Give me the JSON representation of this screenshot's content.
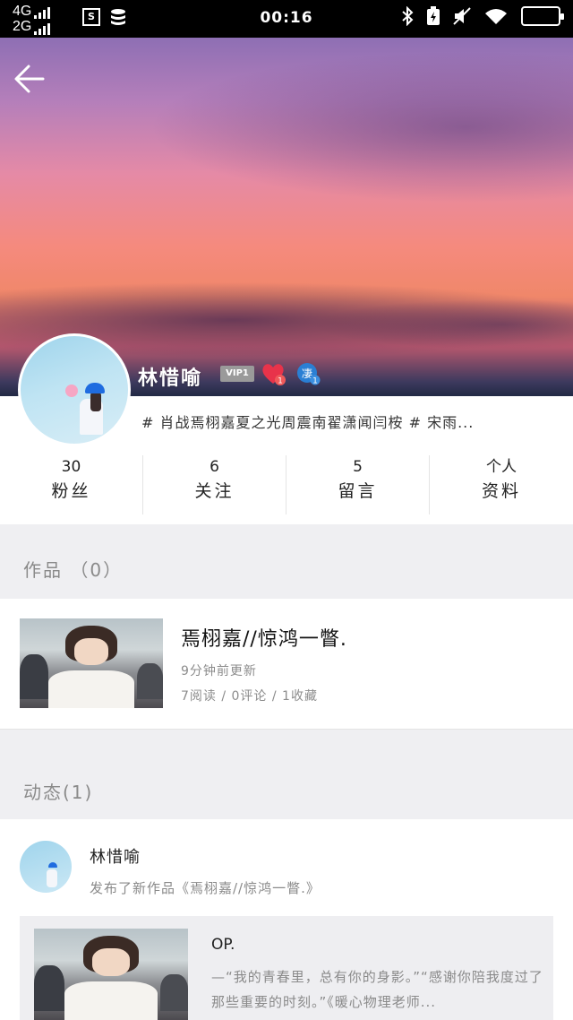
{
  "status_bar": {
    "network_top": "4G",
    "network_bottom": "2G",
    "time": "00:16"
  },
  "profile": {
    "username": "林惜喻",
    "vip_label": "VIP1",
    "heart_badge_count": "1",
    "star_badge_text": "凄",
    "star_badge_count": "1",
    "tags": "# 肖战焉栩嘉夏之光周震南翟潇闻闫桉  # 宋雨..."
  },
  "stats": [
    {
      "value": "30",
      "label": "粉丝"
    },
    {
      "value": "6",
      "label": "关注"
    },
    {
      "value": "5",
      "label": "留言"
    },
    {
      "value": "个人",
      "label": "资料"
    }
  ],
  "works_section": {
    "title": "作品 （0）",
    "item": {
      "title": "焉栩嘉//惊鸿一瞥.",
      "updated": "9分钟前更新",
      "meta": "7阅读 / 0评论 / 1收藏"
    }
  },
  "activity_section": {
    "title": "动态(1)",
    "item": {
      "user": "林惜喻",
      "action": "发布了新作品《焉栩嘉//惊鸿一瞥.》",
      "card_title": "OP.",
      "card_excerpt": "—“我的青春里，总有你的身影。”“感谢你陪我度过了那些重要的时刻。”《暖心物理老师..."
    }
  },
  "colors": {
    "status_bar": "#000000",
    "page_bg": "#efeff2",
    "card_bg": "#ffffff",
    "muted_text": "#8a8a8a",
    "vip_badge": "#9a9a9a",
    "heart_badge": "#e8334a",
    "star_badge": "#2a7fd4"
  }
}
